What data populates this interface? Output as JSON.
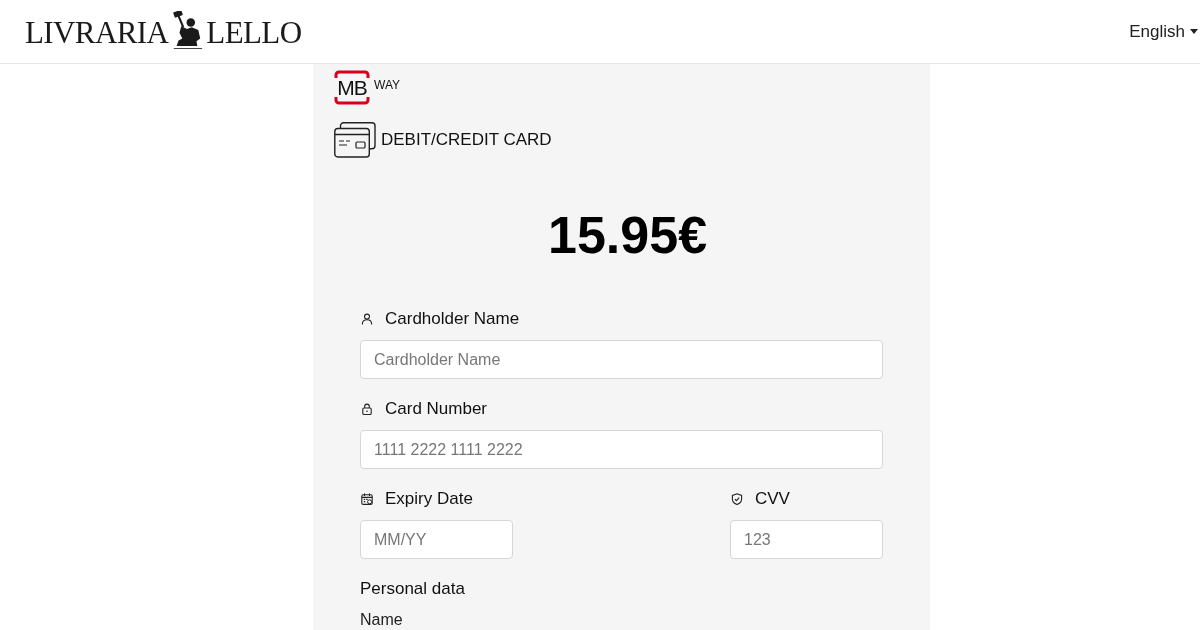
{
  "header": {
    "logo": {
      "left_text": "LIVRARIA",
      "right_text": "LELLO"
    },
    "language": {
      "label": "English"
    }
  },
  "payment_methods": [
    {
      "kind": "mbway",
      "logo_text": "MB",
      "label": "WAY"
    },
    {
      "kind": "card",
      "label": "DEBIT/CREDIT CARD"
    }
  ],
  "amount": "15.95€",
  "card_form": {
    "rows": [
      {
        "fields": [
          {
            "label": "Cardholder Name",
            "placeholder": "Cardholder Name"
          }
        ]
      },
      {
        "fields": [
          {
            "label": "Card Number",
            "placeholder": "1111 2222 1111 2222"
          }
        ]
      },
      {
        "fields": [
          {
            "label": "Expiry Date",
            "placeholder": "MM/YY"
          },
          {
            "label": "CVV",
            "placeholder": "123"
          }
        ]
      }
    ]
  },
  "personal_data": {
    "title": "Personal data",
    "fields": [
      {
        "label": "Name"
      }
    ]
  }
}
